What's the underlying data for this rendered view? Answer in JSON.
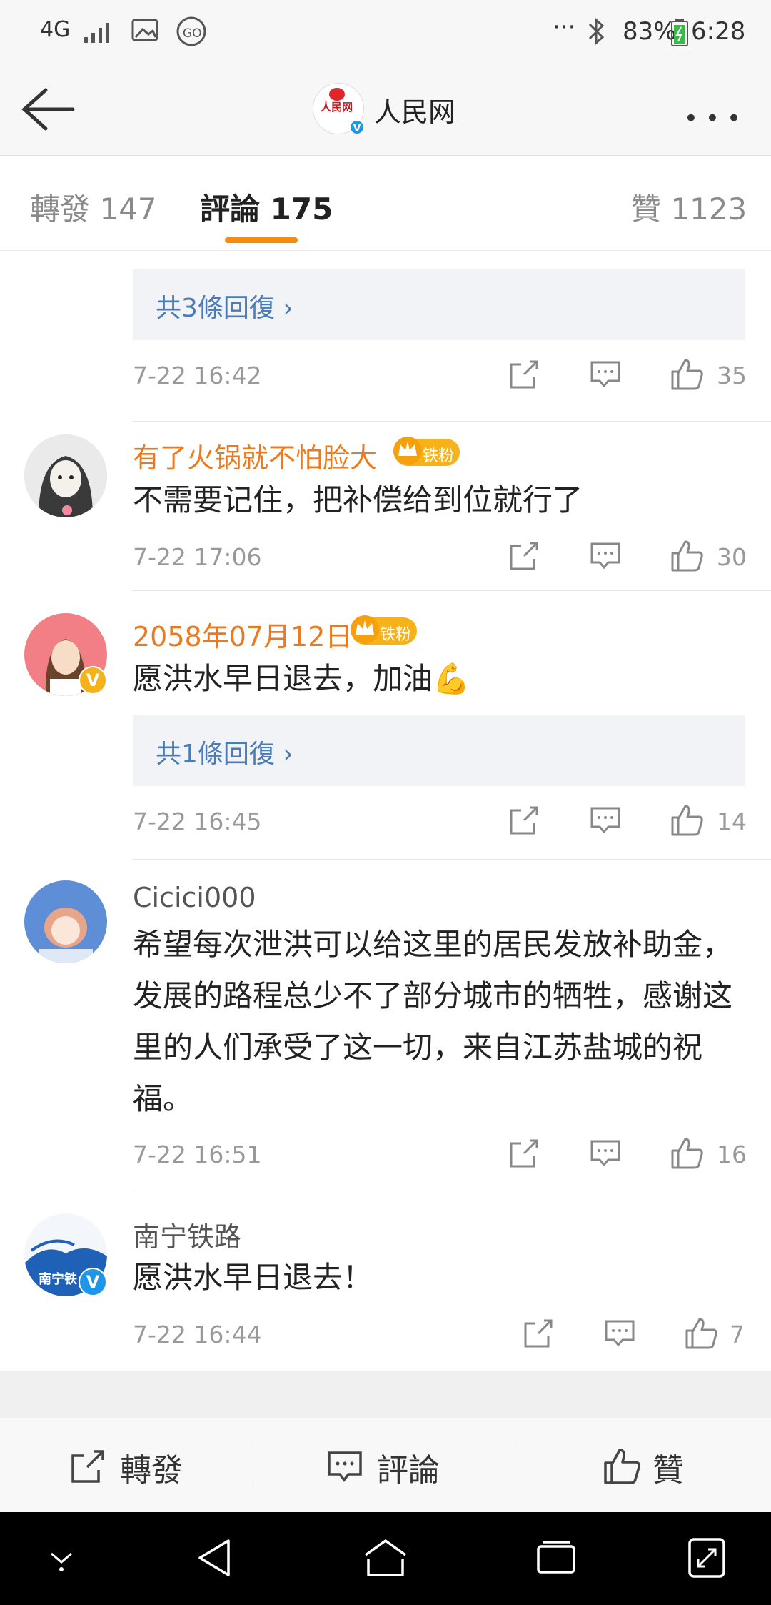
{
  "status_bar": {
    "network": "4G",
    "battery": "83%",
    "time": "6:28",
    "icons": [
      "signal-icon",
      "image-icon",
      "go-icon",
      "overflow-icon",
      "bluetooth-icon",
      "battery-icon"
    ]
  },
  "header": {
    "logo_text": "人民网",
    "title": "人民网",
    "back_icon": "back-arrow-icon",
    "more_icon": "more-dots-icon"
  },
  "tabs": [
    {
      "label": "轉發 147"
    },
    {
      "label": "評論 175",
      "active": true
    },
    {
      "label": "贊 1123"
    }
  ],
  "comments": [
    {
      "reply_summary": "共3條回復 ›",
      "time": "7-22 16:42",
      "likes": "35"
    },
    {
      "author": "有了火锅就不怕脸大",
      "badge": "铁粉",
      "text": "不需要记住，把补偿给到位就行了",
      "time": "7-22 17:06",
      "likes": "30"
    },
    {
      "author": "2058年07月12日",
      "badge": "铁粉",
      "text": "愿洪水早日退去，加油💪",
      "reply_summary": "共1條回復 ›",
      "time": "7-22 16:45",
      "likes": "14"
    },
    {
      "author": "Cicici000",
      "text": "希望每次泄洪可以给这里的居民发放补助金，发展的路程总少不了部分城市的牺牲，感谢这里的人们承受了这一切，来自江苏盐城的祝福。",
      "time": "7-22 16:51",
      "likes": "16"
    },
    {
      "author": "南宁铁路",
      "avatar_text": "南宁铁",
      "text": "愿洪水早日退去！",
      "time": "7-22 16:44",
      "likes": "7"
    }
  ],
  "toolbar": {
    "repost": "轉發",
    "comment": "評論",
    "like": "贊"
  },
  "colors": {
    "accent_orange": "#f58c0c",
    "username_orange": "#eb7a1f",
    "link_blue": "#4a7bb6",
    "badge_gold": "#f6b21a"
  }
}
